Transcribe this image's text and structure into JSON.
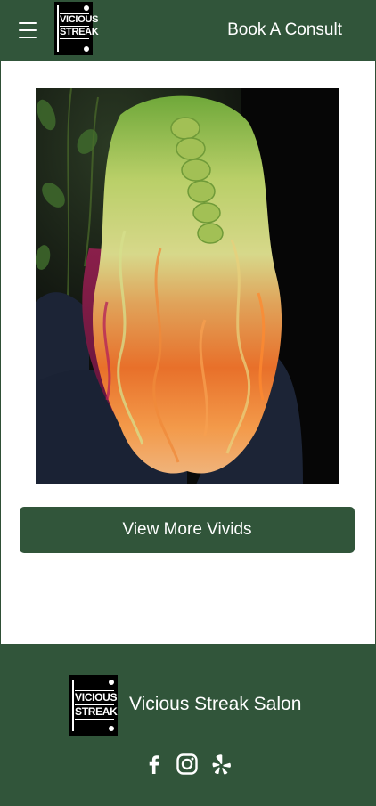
{
  "header": {
    "menu_icon": "hamburger-menu-icon",
    "logo_lines": [
      "VICIOUS",
      "STREAK"
    ],
    "book_label": "Book A Consult"
  },
  "main": {
    "hero_image": "photo of long wavy hair dyed green fading to orange and magenta",
    "cta_label": "View More Vivids"
  },
  "footer": {
    "logo_lines": [
      "VICIOUS",
      "STREAK"
    ],
    "brand_name": "Vicious Streak Salon",
    "social_icons": [
      "facebook-icon",
      "instagram-icon",
      "yelp-icon"
    ]
  },
  "colors": {
    "brand_green": "#31553a",
    "white": "#ffffff",
    "black": "#000000"
  }
}
